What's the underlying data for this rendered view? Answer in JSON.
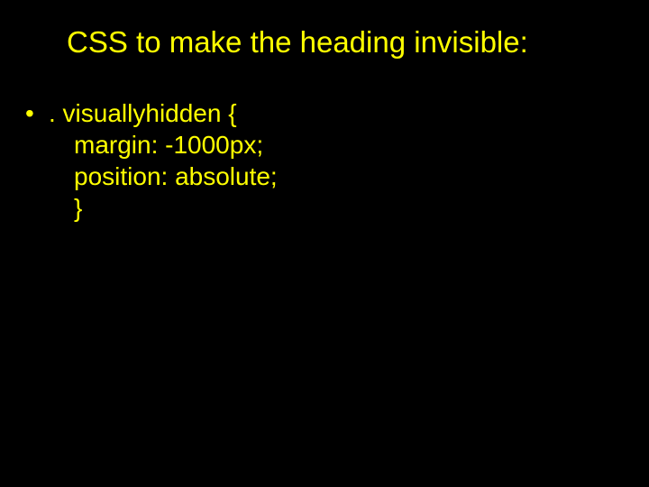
{
  "slide": {
    "title": "CSS to make the heading invisible:",
    "bullet": {
      "line1": ". visuallyhidden {",
      "line2": "margin: -1000px;",
      "line3": "position: absolute;",
      "line4": "}"
    }
  }
}
